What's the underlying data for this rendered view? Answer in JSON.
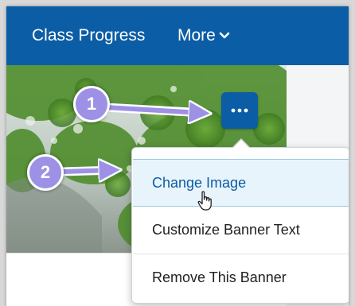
{
  "navbar": {
    "class_progress_label": "Class Progress",
    "more_label": "More",
    "background": "#0b5da6"
  },
  "banner": {
    "image_description_icon": "tree-foliage-photo"
  },
  "more_options_button": {
    "icon": "ellipsis-icon",
    "label": "..."
  },
  "menu": {
    "items": [
      {
        "label": "Change Image",
        "highlighted": true
      },
      {
        "label": "Customize Banner Text",
        "highlighted": false
      },
      {
        "label": "Remove This Banner",
        "highlighted": false
      }
    ]
  },
  "callouts": [
    {
      "number": "1"
    },
    {
      "number": "2"
    }
  ],
  "colors": {
    "accent": "#0b5da6",
    "callout": "#9d91e6",
    "menu_highlight": "#e8f4fb"
  }
}
